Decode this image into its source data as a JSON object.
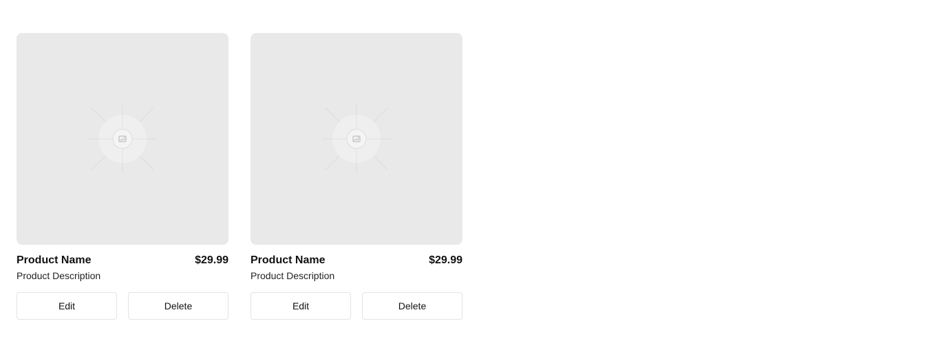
{
  "products": [
    {
      "name": "Product Name",
      "price": "$29.99",
      "description": "Product Description",
      "edit_label": "Edit",
      "delete_label": "Delete",
      "image_icon": "image-placeholder-icon"
    },
    {
      "name": "Product Name",
      "price": "$29.99",
      "description": "Product Description",
      "edit_label": "Edit",
      "delete_label": "Delete",
      "image_icon": "image-placeholder-icon"
    }
  ],
  "colors": {
    "image_background": "#e9e9e9",
    "button_border": "#e3e3e3",
    "text": "#111111"
  }
}
